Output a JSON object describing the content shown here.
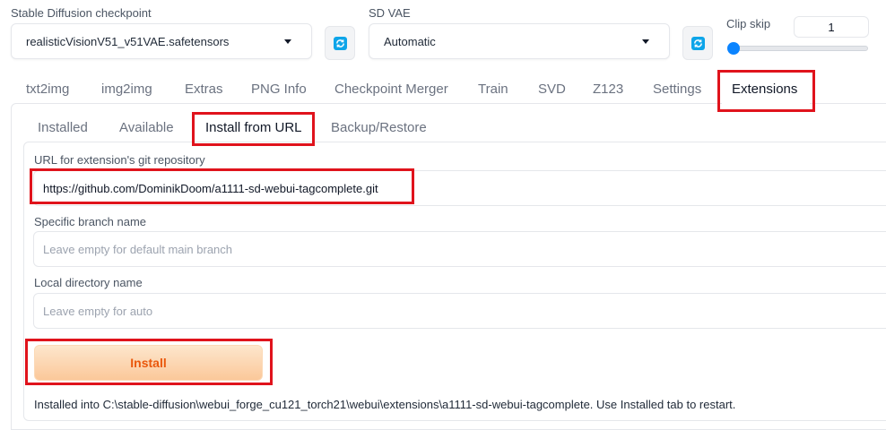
{
  "checkpoint": {
    "label": "Stable Diffusion checkpoint",
    "value": "realisticVisionV51_v51VAE.safetensors"
  },
  "vae": {
    "label": "SD VAE",
    "value": "Automatic"
  },
  "clip_skip": {
    "label": "Clip skip",
    "value": "1",
    "slider_fraction": 0
  },
  "tabs": [
    {
      "label": "txt2img"
    },
    {
      "label": "img2img"
    },
    {
      "label": "Extras"
    },
    {
      "label": "PNG Info"
    },
    {
      "label": "Checkpoint Merger"
    },
    {
      "label": "Train"
    },
    {
      "label": "SVD"
    },
    {
      "label": "Z123"
    },
    {
      "label": "Settings"
    },
    {
      "label": "Extensions"
    }
  ],
  "subtabs": [
    {
      "label": "Installed"
    },
    {
      "label": "Available"
    },
    {
      "label": "Install from URL"
    },
    {
      "label": "Backup/Restore"
    }
  ],
  "form": {
    "url_label": "URL for extension's git repository",
    "url_value": "https://github.com/DominikDoom/a1111-sd-webui-tagcomplete.git",
    "branch_label": "Specific branch name",
    "branch_placeholder": "Leave empty for default main branch",
    "dir_label": "Local directory name",
    "dir_placeholder": "Leave empty for auto",
    "install_label": "Install",
    "result_text": "Installed into C:\\stable-diffusion\\webui_forge_cu121_torch21\\webui\\extensions\\a1111-sd-webui-tagcomplete. Use Installed tab to restart."
  },
  "colors": {
    "highlight": "#e0131c",
    "install_text": "#ea580c",
    "slider": "#0b84ff"
  }
}
